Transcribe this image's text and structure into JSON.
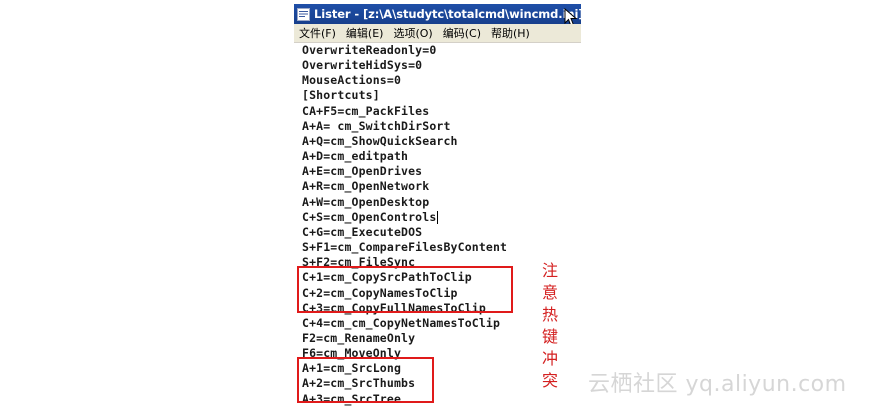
{
  "window": {
    "title": "Lister - [z:\\A\\studytc\\totalcmd\\wincmd.ini]",
    "title_icon": "lister-app-icon",
    "cursor_icon": "mouse-pointer-icon",
    "accent_color": "#1f4fa8",
    "menu_bg_color": "#ece9d8"
  },
  "menu": [
    {
      "label": "文件(F)"
    },
    {
      "label": "编辑(E)"
    },
    {
      "label": "选项(O)"
    },
    {
      "label": "编码(C)"
    },
    {
      "label": "帮助(H)"
    }
  ],
  "lines": [
    "OverwriteReadonly=0",
    "OverwriteHidSys=0",
    "MouseActions=0",
    "[Shortcuts]",
    "CA+F5=cm_PackFiles",
    "A+A= cm_SwitchDirSort",
    "A+Q=cm_ShowQuickSearch",
    "A+D=cm_editpath",
    "A+E=cm_OpenDrives",
    "A+R=cm_OpenNetwork",
    "A+W=cm_OpenDesktop",
    "C+S=cm_OpenControls",
    "C+G=cm_ExecuteDOS",
    "S+F1=cm_CompareFilesByContent",
    "S+F2=cm_FileSync",
    "C+1=cm_CopySrcPathToClip",
    "C+2=cm_CopyNamesToClip",
    "C+3=cm_CopyFullNamesToClip",
    "C+4=cm_cm_CopyNetNamesToClip",
    "F2=cm_RenameOnly",
    "F6=cm_MoveOnly",
    "A+1=cm_SrcLong",
    "A+2=cm_SrcThumbs",
    "A+3=cm_SrcTree"
  ],
  "annotation": {
    "color": "#e01a1a",
    "chars": [
      "注",
      "意",
      "热",
      "键",
      "冲",
      "突"
    ]
  },
  "watermark": "云栖社区 yq.aliyun.com"
}
